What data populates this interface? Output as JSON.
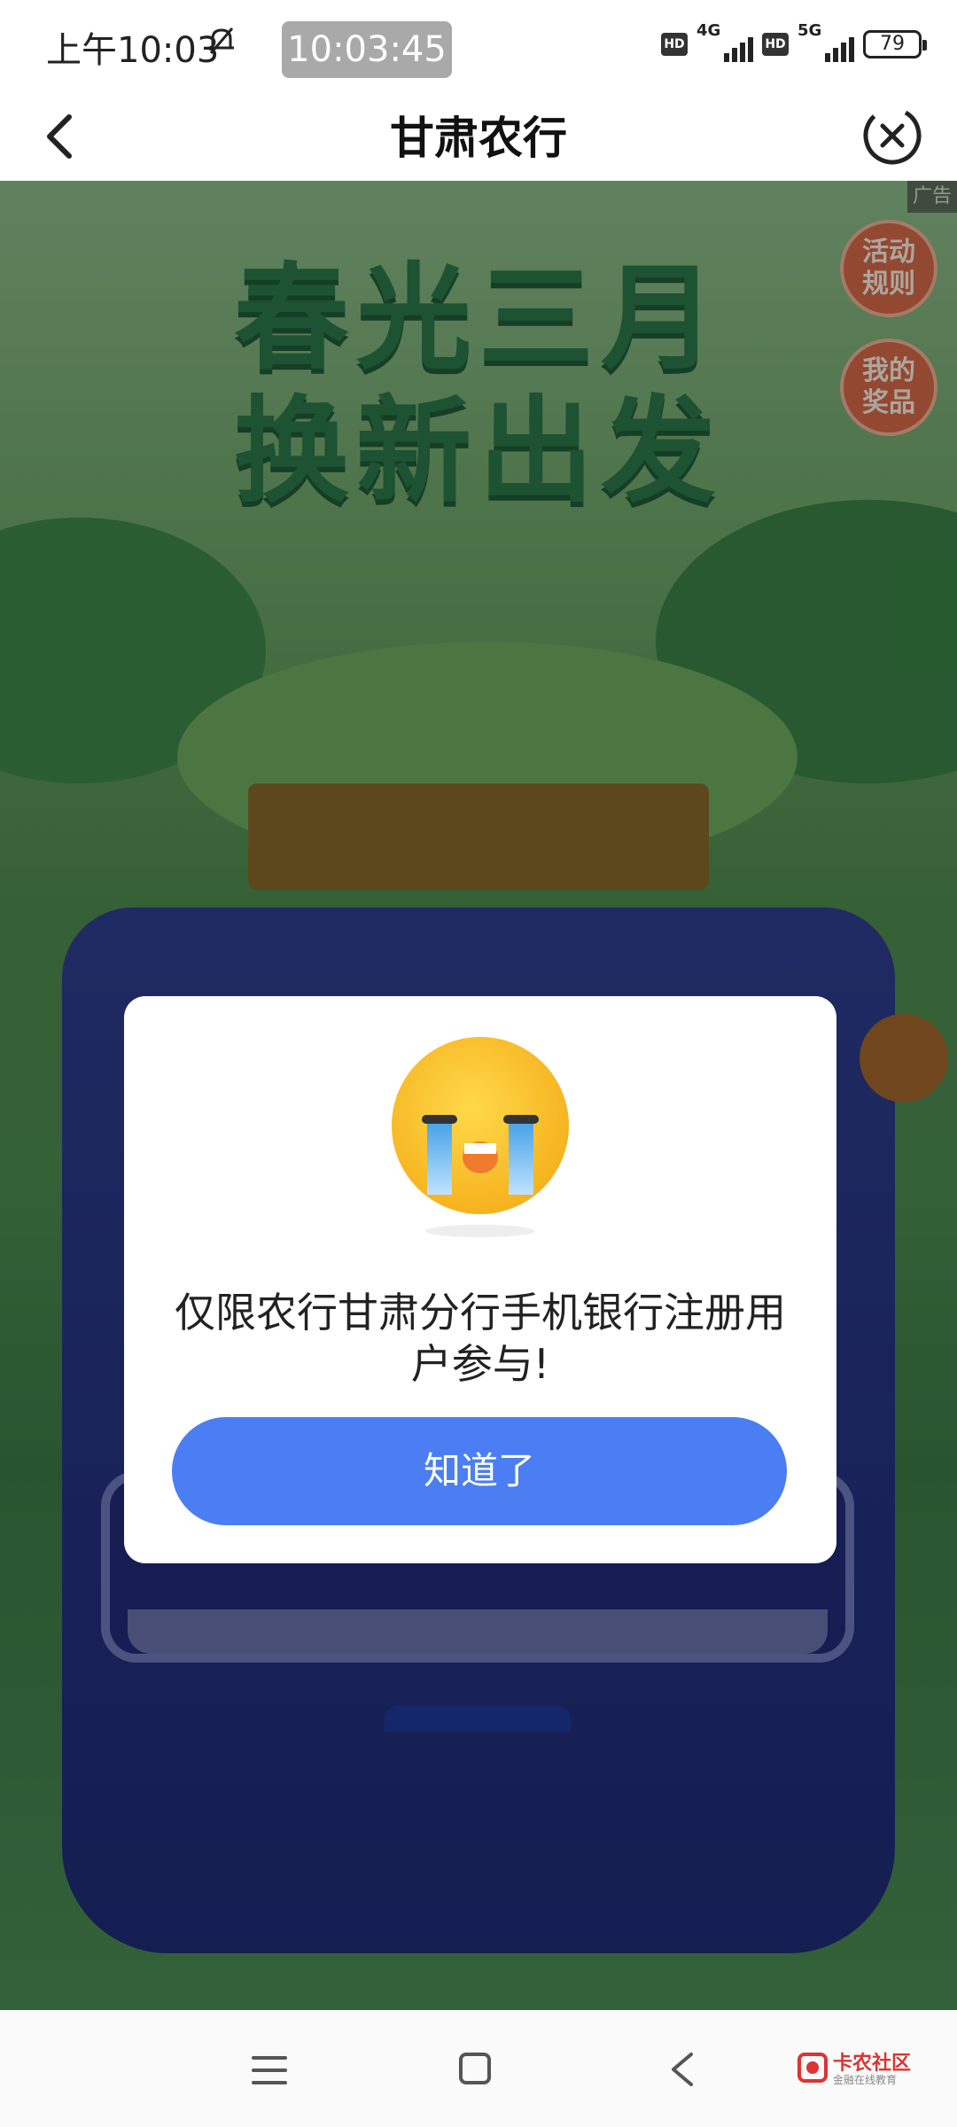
{
  "status_bar": {
    "time": "上午10:03",
    "screen_recorder_time": "10:03:45",
    "hd1": "HD",
    "net1": "4G",
    "hd2": "HD",
    "net2": "5G",
    "battery": "79",
    "icons": [
      "bell-off-icon",
      "signal-icon",
      "battery-icon"
    ]
  },
  "header": {
    "title": "甘肃农行",
    "back_icon": "chevron-left-icon",
    "close_icon": "close-circle-icon"
  },
  "banner": {
    "ad_label": "广告",
    "headline_line1": "春光三月",
    "headline_line2": "换新出发",
    "rules_button": "活动规则",
    "prizes_button": "我的奖品"
  },
  "dialog": {
    "face_icon": "crying-face-icon",
    "message": "仅限农行甘肃分行手机银行注册用户参与!",
    "confirm_button": "知道了"
  },
  "nav_bar": {
    "icons": [
      "menu-icon",
      "home-square-icon",
      "back-triangle-icon"
    ]
  },
  "watermark": {
    "name": "卡农社区",
    "sub": "金融在线教育"
  },
  "colors": {
    "primary_button": "#4a7ef2",
    "side_button": "#d96b4a",
    "headline": "#2c7a4a",
    "machine": "#2f3f92"
  }
}
